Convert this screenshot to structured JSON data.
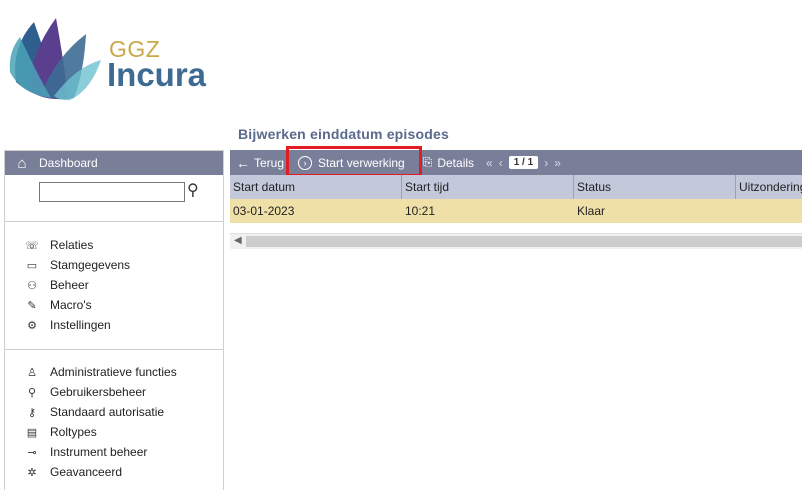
{
  "brand": {
    "line1": "GGZ",
    "line2": "Incura",
    "colors": {
      "gold": "#c9a74a",
      "blue": "#3d6b93",
      "teal": "#4aa3b7",
      "purple": "#5b3f8f"
    }
  },
  "page_title": "Bijwerken einddatum episodes",
  "sidebar": {
    "header_label": "Dashboard",
    "header_icon": "home-icon",
    "search": {
      "value": "",
      "icon": "search-icon"
    },
    "group1": [
      {
        "label": "Relaties",
        "icon": "handshake-icon"
      },
      {
        "label": "Stamgegevens",
        "icon": "inbox-icon"
      },
      {
        "label": "Beheer",
        "icon": "people-icon"
      },
      {
        "label": "Macro's",
        "icon": "edit-document-icon"
      },
      {
        "label": "Instellingen",
        "icon": "gear-icon"
      }
    ],
    "group2": [
      {
        "label": "Administratieve functies",
        "icon": "stamp-icon"
      },
      {
        "label": "Gebruikersbeheer",
        "icon": "user-settings-icon"
      },
      {
        "label": "Standaard autorisatie",
        "icon": "key-icon"
      },
      {
        "label": "Roltypes",
        "icon": "id-card-icon"
      },
      {
        "label": "Instrument beheer",
        "icon": "instrument-icon"
      },
      {
        "label": "Geavanceerd",
        "icon": "gears-icon"
      }
    ]
  },
  "toolbar": {
    "back_label": "Terug",
    "start_label": "Start verwerking",
    "details_label": "Details",
    "page_indicator": "1 / 1",
    "bg_color": "#7a7f99",
    "highlight_color": "#e31b23"
  },
  "grid": {
    "columns": [
      "Start datum",
      "Start tijd",
      "Status",
      "Uitzondering"
    ],
    "rows": [
      [
        "03-01-2023",
        "10:21",
        "Klaar",
        ""
      ]
    ],
    "selected_row_color": "#efe0a8",
    "header_color": "#c3c9db"
  }
}
